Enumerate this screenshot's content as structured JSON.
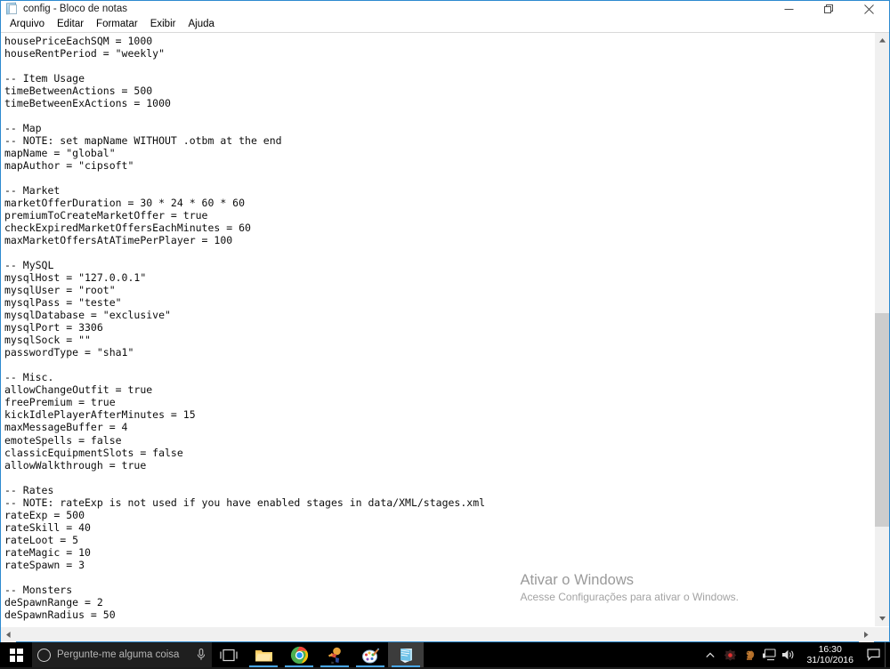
{
  "window": {
    "title": "config - Bloco de notas",
    "icon": "notepad-icon",
    "controls": {
      "minimize_label": "Minimizar",
      "maximize_label": "Restaurar",
      "close_label": "Fechar"
    }
  },
  "menu": {
    "items": [
      {
        "label": "Arquivo"
      },
      {
        "label": "Editar"
      },
      {
        "label": "Formatar"
      },
      {
        "label": "Exibir"
      },
      {
        "label": "Ajuda"
      }
    ]
  },
  "editor": {
    "text": "housePriceEachSQM = 1000\nhouseRentPeriod = \"weekly\"\n\n-- Item Usage\ntimeBetweenActions = 500\ntimeBetweenExActions = 1000\n\n-- Map\n-- NOTE: set mapName WITHOUT .otbm at the end\nmapName = \"global\"\nmapAuthor = \"cipsoft\"\n\n-- Market\nmarketOfferDuration = 30 * 24 * 60 * 60\npremiumToCreateMarketOffer = true\ncheckExpiredMarketOffersEachMinutes = 60\nmaxMarketOffersAtATimePerPlayer = 100\n\n-- MySQL\nmysqlHost = \"127.0.0.1\"\nmysqlUser = \"root\"\nmysqlPass = \"teste\"\nmysqlDatabase = \"exclusive\"\nmysqlPort = 3306\nmysqlSock = \"\"\npasswordType = \"sha1\"\n\n-- Misc.\nallowChangeOutfit = true\nfreePremium = true\nkickIdlePlayerAfterMinutes = 15\nmaxMessageBuffer = 4\nemoteSpells = false\nclassicEquipmentSlots = false\nallowWalkthrough = true\n\n-- Rates\n-- NOTE: rateExp is not used if you have enabled stages in data/XML/stages.xml\nrateExp = 500\nrateSkill = 40\nrateLoot = 5\nrateMagic = 10\nrateSpawn = 3\n\n-- Monsters\ndeSpawnRange = 2\ndeSpawnRadius = 50"
  },
  "watermark": {
    "title": "Ativar o Windows",
    "subtitle": "Acesse Configurações para ativar o Windows."
  },
  "scrollbars": {
    "vertical": {
      "up_icon": "chevron-up-icon",
      "down_icon": "chevron-down-icon",
      "thumb_top_pct": 47,
      "thumb_height_pct": 38
    },
    "horizontal": {
      "left_icon": "chevron-left-icon",
      "right_icon": "chevron-right-icon"
    }
  },
  "taskbar": {
    "start_label": "Iniciar",
    "search": {
      "placeholder": "Pergunte-me alguma coisa",
      "cortana_icon": "cortana-circle-icon",
      "mic_icon": "microphone-icon"
    },
    "taskview_label": "Visão de tarefas",
    "apps": [
      {
        "name": "file-explorer",
        "label": "Explorador de Arquivos",
        "active": false,
        "running": true
      },
      {
        "name": "google-chrome",
        "label": "Google Chrome",
        "active": false,
        "running": true
      },
      {
        "name": "game-client",
        "label": "Cliente de jogo",
        "active": false,
        "running": true
      },
      {
        "name": "paint",
        "label": "Paint",
        "active": false,
        "running": true
      },
      {
        "name": "notepad",
        "label": "Bloco de notas",
        "active": true,
        "running": true
      }
    ],
    "tray": {
      "expand_icon": "chevron-up-icon",
      "icons": [
        {
          "name": "antivirus-icon",
          "label": "Antivírus"
        },
        {
          "name": "squirrel-icon",
          "label": "Aplicativo em execução"
        },
        {
          "name": "network-icon",
          "label": "Rede"
        },
        {
          "name": "volume-icon",
          "label": "Volume"
        }
      ],
      "clock": {
        "time": "16:30",
        "date": "31/10/2016"
      },
      "action_center_icon": "action-center-icon",
      "show_desktop_label": "Mostrar área de trabalho"
    }
  },
  "colors": {
    "accent": "#2d8ad0",
    "taskbar_bg": "#000000",
    "window_bg": "#ffffff",
    "text": "#0d0d0d",
    "scrollbar_thumb": "#cdcdcd",
    "watermark_text": "#9a9a9a",
    "task_underline": "#4aa8e8"
  }
}
